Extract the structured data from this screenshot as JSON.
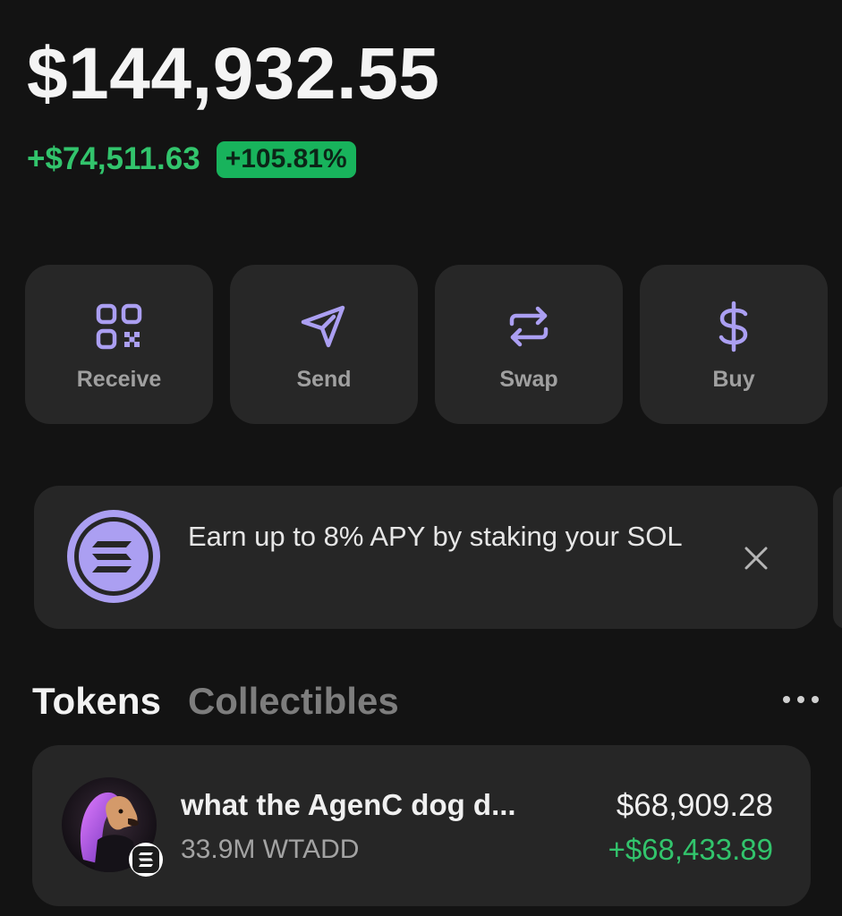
{
  "balance": {
    "total": "$144,932.55",
    "change_amount": "+$74,511.63",
    "change_percent": "+105.81%"
  },
  "actions": [
    {
      "label": "Receive",
      "icon": "qr-code-icon"
    },
    {
      "label": "Send",
      "icon": "send-icon"
    },
    {
      "label": "Swap",
      "icon": "swap-icon"
    },
    {
      "label": "Buy",
      "icon": "dollar-icon"
    }
  ],
  "banner": {
    "text": "Earn up to 8% APY by staking your SOL",
    "icon": "solana-icon",
    "close_icon": "close-icon"
  },
  "tabs": {
    "tokens": "Tokens",
    "collectibles": "Collectibles",
    "more_icon": "more-icon"
  },
  "tokens": [
    {
      "name": "what the AgenC dog d...",
      "amount": "33.9M WTADD",
      "value": "$68,909.28",
      "change": "+$68,433.89"
    }
  ],
  "colors": {
    "background": "#131313",
    "card": "#272727",
    "accent": "#ab9ff2",
    "positive": "#32c46c"
  }
}
